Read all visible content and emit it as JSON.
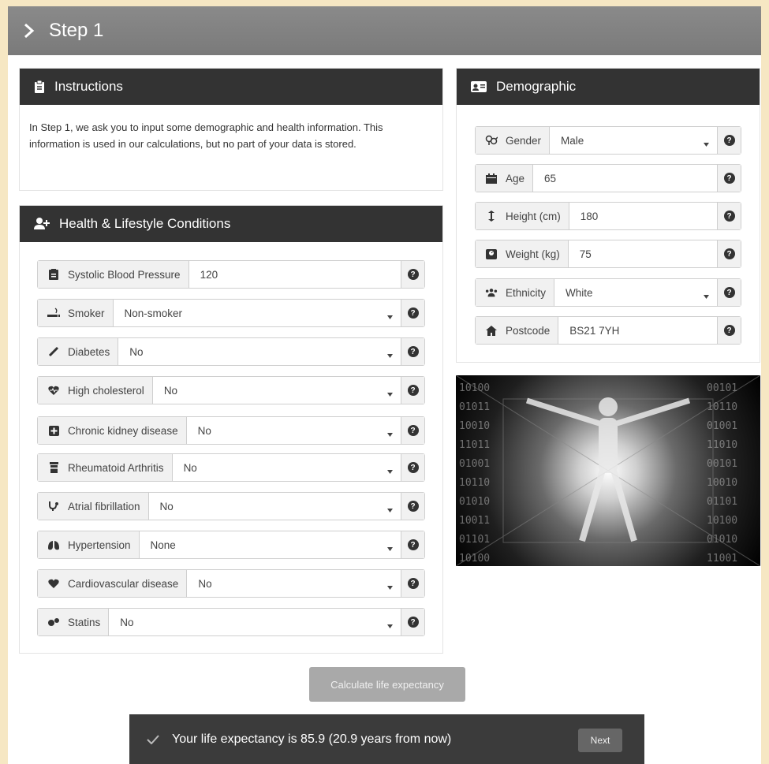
{
  "step_header": {
    "title": "Step 1"
  },
  "instructions": {
    "title": "Instructions",
    "text": "In Step 1, we ask you to input some demographic and health information. This information is used in our calculations, but no part of your data is stored."
  },
  "health": {
    "title": "Health & Lifestyle Conditions",
    "fields": [
      {
        "label": "Systolic Blood Pressure",
        "value": "120",
        "icon": "clipboard-icon",
        "type": "input"
      },
      {
        "label": "Smoker",
        "value": "Non-smoker",
        "icon": "smoking-icon",
        "type": "select"
      },
      {
        "label": "Diabetes",
        "value": "No",
        "icon": "syringe-icon",
        "type": "select"
      },
      {
        "label": "High cholesterol",
        "value": "No",
        "icon": "heartbeat-icon",
        "type": "select"
      },
      {
        "label": "Chronic kidney disease",
        "value": "No",
        "icon": "plus-square-icon",
        "type": "select"
      },
      {
        "label": "Rheumatoid Arthritis",
        "value": "No",
        "icon": "prescription-bottle-icon",
        "type": "select"
      },
      {
        "label": "Atrial fibrillation",
        "value": "No",
        "icon": "stethoscope-icon",
        "type": "select"
      },
      {
        "label": "Hypertension",
        "value": "None",
        "icon": "lungs-icon",
        "type": "select"
      },
      {
        "label": "Cardiovascular disease",
        "value": "No",
        "icon": "heart-icon",
        "type": "select"
      },
      {
        "label": "Statins",
        "value": "No",
        "icon": "pills-icon",
        "type": "select"
      }
    ]
  },
  "demographic": {
    "title": "Demographic",
    "fields": [
      {
        "label": "Gender",
        "value": "Male",
        "icon": "venus-mars-icon",
        "type": "select"
      },
      {
        "label": "Age",
        "value": "65",
        "icon": "calendar-icon",
        "type": "input"
      },
      {
        "label": "Height (cm)",
        "value": "180",
        "icon": "height-arrow-icon",
        "type": "input"
      },
      {
        "label": "Weight (kg)",
        "value": "75",
        "icon": "weight-scale-icon",
        "type": "input"
      },
      {
        "label": "Ethnicity",
        "value": "White",
        "icon": "users-icon",
        "type": "select"
      },
      {
        "label": "Postcode",
        "value": "BS21 7YH",
        "icon": "home-icon",
        "type": "input"
      }
    ]
  },
  "image": {
    "subject": "human figure in binary data tunnel"
  },
  "actions": {
    "calculate_label": "Calculate life expectancy"
  },
  "result": {
    "text": "Your life expectancy is 85.9 (20.9 years from now)",
    "next_label": "Next"
  },
  "colors": {
    "header_bg": "#7f7f7f",
    "panel_head_bg": "#333333",
    "page_bg": "#f6e7c3",
    "result_bg": "#3b3b3b"
  }
}
